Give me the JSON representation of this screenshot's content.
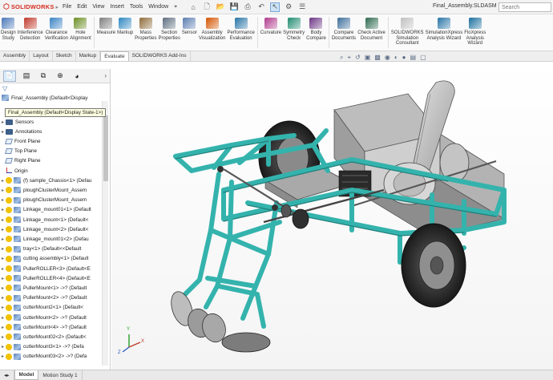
{
  "app": {
    "logo_text": "SOLIDWORKS",
    "document_title": "Final_Assembly.SLDASM *",
    "search_placeholder": "Search"
  },
  "menu": [
    "File",
    "Edit",
    "View",
    "Insert",
    "Tools",
    "Window"
  ],
  "ribbon": {
    "buttons": [
      {
        "label": "Design\nStudy",
        "color": "#4a78b8"
      },
      {
        "label": "Interference\nDetection",
        "color": "#c0392b"
      },
      {
        "label": "Clearance\nVerification",
        "color": "#3b82c4"
      },
      {
        "label": "Hole\nAlignment",
        "color": "#6b8e23"
      },
      {
        "label": "Measure",
        "color": "#7f7f7f"
      },
      {
        "label": "Markup",
        "color": "#2e86c1"
      },
      {
        "label": "Mass\nProperties",
        "color": "#8e6c3a"
      },
      {
        "label": "Section\nProperties",
        "color": "#5d6d7e"
      },
      {
        "label": "Sensor",
        "color": "#5b7db1"
      },
      {
        "label": "Assembly\nVisualization",
        "color": "#d35400"
      },
      {
        "label": "Performance\nEvaluation",
        "color": "#2874a6"
      },
      {
        "label": "Curvature",
        "color": "#b03a8c"
      },
      {
        "label": "Symmetry\nCheck",
        "color": "#1f8a70"
      },
      {
        "label": "Body\nCompare",
        "color": "#6c3483"
      },
      {
        "label": "Compare\nDocuments",
        "color": "#3c6e9a"
      },
      {
        "label": "Check Active\nDocument",
        "color": "#2d6a4f"
      },
      {
        "label": "SOLIDWORKS\nSimulation\nConsultant",
        "color": "#bfbfbf"
      },
      {
        "label": "SimulationXpress\nAnalysis Wizard",
        "color": "#2874a6"
      },
      {
        "label": "FloXpress\nAnalysis\nWizard",
        "color": "#1a6f9e"
      }
    ]
  },
  "tabs": [
    "Assembly",
    "Layout",
    "Sketch",
    "Markup",
    "Evaluate",
    "SOLIDWORKS Add-Ins"
  ],
  "active_tab": "Evaluate",
  "feature_tree": {
    "root": "Final_Assembly  (Default<Display",
    "tooltip": "Final_Assembly  (Default<Display State-1>)",
    "items": [
      {
        "kind": "folder",
        "label": "Sensors"
      },
      {
        "kind": "folder",
        "label": "Annotations"
      },
      {
        "kind": "plane",
        "label": "Front Plane"
      },
      {
        "kind": "plane",
        "label": "Top Plane"
      },
      {
        "kind": "plane",
        "label": "Right Plane"
      },
      {
        "kind": "origin",
        "label": "Origin"
      },
      {
        "kind": "comp",
        "label": "(f) sample_Chassis<1> (Defau"
      },
      {
        "kind": "comp",
        "label": "ploughClusterMount_Assem"
      },
      {
        "kind": "comp",
        "label": "ploughClusterMount_Assem"
      },
      {
        "kind": "comp",
        "label": "Linkage_mount01<1> (Default"
      },
      {
        "kind": "comp",
        "label": "Linkage_mount<1> (Default<"
      },
      {
        "kind": "comp",
        "label": "Linkage_mount<2> (Default<"
      },
      {
        "kind": "comp",
        "label": "Linkage_mount01<2> (Defau"
      },
      {
        "kind": "comp",
        "label": "tray<1> (Default<<Default"
      },
      {
        "kind": "comp",
        "label": "cutting assembly<1> (Default"
      },
      {
        "kind": "comp",
        "label": "PullerROLLER<3> (Default<E"
      },
      {
        "kind": "comp",
        "label": "PullerROLLER<4> (Default<E"
      },
      {
        "kind": "comp",
        "label": "PullerMount<1> ->? (Default"
      },
      {
        "kind": "comp",
        "label": "PullerMount<2> ->? (Default"
      },
      {
        "kind": "comp",
        "label": "cutterMount2<1> (Default<"
      },
      {
        "kind": "comp",
        "label": "cutterMount<2> ->? (Default"
      },
      {
        "kind": "comp",
        "label": "cutterMount<4> ->? (Default"
      },
      {
        "kind": "comp",
        "label": "cutterMount02<2> (Default<"
      },
      {
        "kind": "comp",
        "label": "cutterMount3<1> ->? (Defa"
      },
      {
        "kind": "comp",
        "label": "cutterMount03<2> ->? (Defa"
      }
    ]
  },
  "bottom_tabs": [
    "Model",
    "Motion Study 1"
  ],
  "triad": {
    "x": "X",
    "y": "Y",
    "z": "Z"
  },
  "colors": {
    "frame": "#34b3ad",
    "frame_dark": "#1f7f7a",
    "metal": "#c9c9c9",
    "tire": "#2b2b2b"
  }
}
